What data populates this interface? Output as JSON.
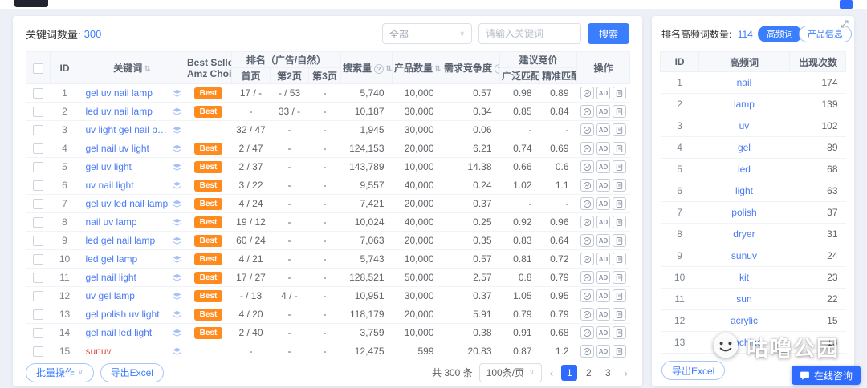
{
  "icons": {
    "sort": "⇅",
    "help": "?",
    "dropdown": "∨",
    "prev": "‹",
    "next": "›"
  },
  "keywords_panel": {
    "count_label": "关键词数量:",
    "count": "300",
    "filter_selected": "全部",
    "search_placeholder": "请输入关键词",
    "search_button": "搜索",
    "table": {
      "badge_label": "Best",
      "headers": {
        "id": "ID",
        "keyword": "关键词",
        "best_seller_line1": "Best Seller",
        "best_seller_line2": "Amz Choice",
        "rank_group": "排名（广告/自然）",
        "rank_page1": "首页",
        "rank_page2": "第2页",
        "rank_page3": "第3页",
        "search_volume": "搜索量",
        "product_count": "产品数量",
        "demand_ratio": "需求竞争度",
        "bid_group": "建议竞价",
        "bid_broad": "广泛匹配",
        "bid_exact": "精准匹配",
        "actions": "操作"
      },
      "rows": [
        {
          "id": 1,
          "keyword": "gel uv nail lamp",
          "best": true,
          "rank_p1": "17 / -",
          "rank_p2": "- / 53",
          "rank_p3": "-",
          "search_volume": "5,740",
          "product_count": "10,000",
          "demand": "0.57",
          "bid_broad": "0.98",
          "bid_exact": "0.89"
        },
        {
          "id": 2,
          "keyword": "led uv nail lamp",
          "best": true,
          "rank_p1": "-",
          "rank_p2": "33 / -",
          "rank_p3": "-",
          "search_volume": "10,187",
          "product_count": "30,000",
          "demand": "0.34",
          "bid_broad": "0.85",
          "bid_exact": "0.84"
        },
        {
          "id": 3,
          "keyword": "uv light gel nail polish",
          "best": false,
          "rank_p1": "32 / 47",
          "rank_p2": "-",
          "rank_p3": "-",
          "search_volume": "1,945",
          "product_count": "30,000",
          "demand": "0.06",
          "bid_broad": "-",
          "bid_exact": "-"
        },
        {
          "id": 4,
          "keyword": "gel nail uv light",
          "best": true,
          "rank_p1": "2 / 47",
          "rank_p2": "-",
          "rank_p3": "-",
          "search_volume": "124,153",
          "product_count": "20,000",
          "demand": "6.21",
          "bid_broad": "0.74",
          "bid_exact": "0.69"
        },
        {
          "id": 5,
          "keyword": "gel uv light",
          "best": true,
          "rank_p1": "2 / 37",
          "rank_p2": "-",
          "rank_p3": "-",
          "search_volume": "143,789",
          "product_count": "10,000",
          "demand": "14.38",
          "bid_broad": "0.66",
          "bid_exact": "0.6"
        },
        {
          "id": 6,
          "keyword": "uv nail light",
          "best": true,
          "rank_p1": "3 / 22",
          "rank_p2": "-",
          "rank_p3": "-",
          "search_volume": "9,557",
          "product_count": "40,000",
          "demand": "0.24",
          "bid_broad": "1.02",
          "bid_exact": "1.1"
        },
        {
          "id": 7,
          "keyword": "gel uv led nail lamp",
          "best": true,
          "rank_p1": "4 / 24",
          "rank_p2": "-",
          "rank_p3": "-",
          "search_volume": "7,421",
          "product_count": "20,000",
          "demand": "0.37",
          "bid_broad": "-",
          "bid_exact": "-"
        },
        {
          "id": 8,
          "keyword": "nail uv lamp",
          "best": true,
          "rank_p1": "19 / 12",
          "rank_p2": "-",
          "rank_p3": "-",
          "search_volume": "10,024",
          "product_count": "40,000",
          "demand": "0.25",
          "bid_broad": "0.92",
          "bid_exact": "0.96"
        },
        {
          "id": 9,
          "keyword": "led gel nail lamp",
          "best": true,
          "rank_p1": "60 / 24",
          "rank_p2": "-",
          "rank_p3": "-",
          "search_volume": "7,063",
          "product_count": "20,000",
          "demand": "0.35",
          "bid_broad": "0.83",
          "bid_exact": "0.64"
        },
        {
          "id": 10,
          "keyword": "led gel lamp",
          "best": true,
          "rank_p1": "4 / 21",
          "rank_p2": "-",
          "rank_p3": "-",
          "search_volume": "5,743",
          "product_count": "10,000",
          "demand": "0.57",
          "bid_broad": "0.81",
          "bid_exact": "0.72"
        },
        {
          "id": 11,
          "keyword": "gel nail light",
          "best": true,
          "rank_p1": "17 / 27",
          "rank_p2": "-",
          "rank_p3": "-",
          "search_volume": "128,521",
          "product_count": "50,000",
          "demand": "2.57",
          "bid_broad": "0.8",
          "bid_exact": "0.79"
        },
        {
          "id": 12,
          "keyword": "uv gel lamp",
          "best": true,
          "rank_p1": "- / 13",
          "rank_p2": "4 / -",
          "rank_p3": "-",
          "search_volume": "10,951",
          "product_count": "30,000",
          "demand": "0.37",
          "bid_broad": "1.05",
          "bid_exact": "0.95"
        },
        {
          "id": 13,
          "keyword": "gel polish uv light",
          "best": true,
          "rank_p1": "4 / 20",
          "rank_p2": "-",
          "rank_p3": "-",
          "search_volume": "118,179",
          "product_count": "20,000",
          "demand": "5.91",
          "bid_broad": "0.79",
          "bid_exact": "0.79"
        },
        {
          "id": 14,
          "keyword": "gel nail led light",
          "best": true,
          "rank_p1": "2 / 40",
          "rank_p2": "-",
          "rank_p3": "-",
          "search_volume": "3,759",
          "product_count": "10,000",
          "demand": "0.38",
          "bid_broad": "0.91",
          "bid_exact": "0.68"
        },
        {
          "id": 15,
          "keyword": "sunuv",
          "best": false,
          "keyword_color": "#e25449",
          "rank_p1": "-",
          "rank_p2": "-",
          "rank_p3": "-",
          "search_volume": "12,475",
          "product_count": "599",
          "demand": "20.83",
          "bid_broad": "0.87",
          "bid_exact": "1.2"
        }
      ]
    },
    "footer": {
      "batch_button": "批量操作",
      "export_button": "导出Excel",
      "total": "共 300 条",
      "page_size": "100条/页",
      "pages": [
        "1",
        "2",
        "3"
      ],
      "active_page": 0
    }
  },
  "freq_panel": {
    "count_label": "排名高频词数量:",
    "count": "114",
    "tab_freq": "高频词",
    "tab_product": "产品信息",
    "headers": {
      "id": "ID",
      "word": "高频词",
      "count": "出现次数"
    },
    "rows": [
      {
        "id": 1,
        "word": "nail",
        "count": "174"
      },
      {
        "id": 2,
        "word": "lamp",
        "count": "139"
      },
      {
        "id": 3,
        "word": "uv",
        "count": "102"
      },
      {
        "id": 4,
        "word": "gel",
        "count": "89"
      },
      {
        "id": 5,
        "word": "led",
        "count": "68"
      },
      {
        "id": 6,
        "word": "light",
        "count": "63"
      },
      {
        "id": 7,
        "word": "polish",
        "count": "37"
      },
      {
        "id": 8,
        "word": "dryer",
        "count": "31"
      },
      {
        "id": 9,
        "word": "sunuv",
        "count": "24"
      },
      {
        "id": 10,
        "word": "kit",
        "count": "23"
      },
      {
        "id": 11,
        "word": "sun",
        "count": "22"
      },
      {
        "id": 12,
        "word": "acrylic",
        "count": "15"
      },
      {
        "id": 13,
        "word": "machine",
        "count": "13"
      }
    ],
    "export_button": "导出Excel"
  },
  "watermark": {
    "text": "咕噜公园"
  },
  "chat_button": "在线咨询"
}
